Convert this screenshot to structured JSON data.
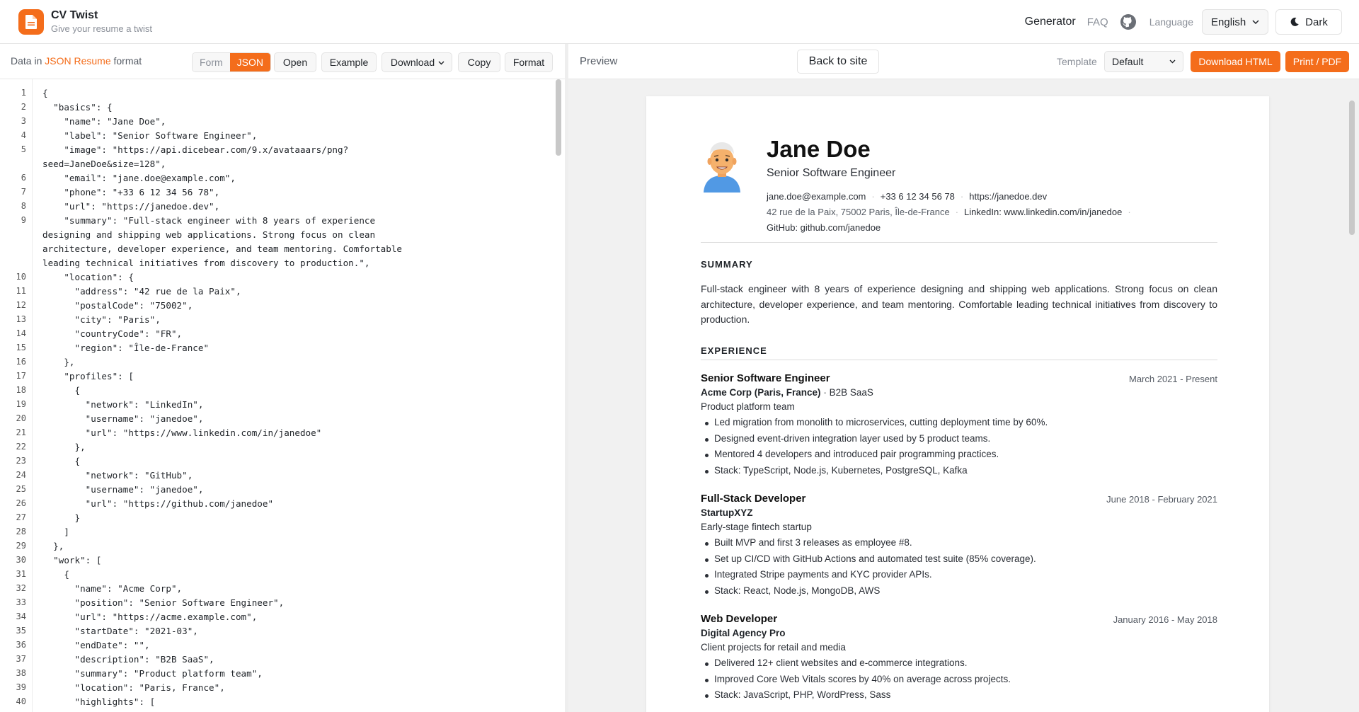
{
  "header": {
    "app_title": "CV Twist",
    "tagline": "Give your resume a twist",
    "nav_generator": "Generator",
    "nav_faq": "FAQ",
    "github_icon": "github-icon",
    "language_label": "Language",
    "language_value": "English",
    "theme_button": "Dark"
  },
  "editor_toolbar": {
    "label_prefix": "Data in",
    "label_highlight": "JSON Resume",
    "label_suffix": "format",
    "mode_form": "Form",
    "mode_json": "JSON",
    "open": "Open",
    "example": "Example",
    "download": "Download",
    "copy": "Copy",
    "format": "Format"
  },
  "editor": {
    "lines": [
      {
        "n": "1",
        "t": "{"
      },
      {
        "n": "2",
        "t": "  \"basics\": {"
      },
      {
        "n": "3",
        "t": "    \"name\": \"Jane Doe\","
      },
      {
        "n": "4",
        "t": "    \"label\": \"Senior Software Engineer\","
      },
      {
        "n": "5",
        "t": "    \"image\": \"https://api.dicebear.com/9.x/avataaars/png?"
      },
      {
        "n": "",
        "t": "seed=JaneDoe&size=128\","
      },
      {
        "n": "6",
        "t": "    \"email\": \"jane.doe@example.com\","
      },
      {
        "n": "7",
        "t": "    \"phone\": \"+33 6 12 34 56 78\","
      },
      {
        "n": "8",
        "t": "    \"url\": \"https://janedoe.dev\","
      },
      {
        "n": "9",
        "t": "    \"summary\": \"Full-stack engineer with 8 years of experience"
      },
      {
        "n": "",
        "t": "designing and shipping web applications. Strong focus on clean"
      },
      {
        "n": "",
        "t": "architecture, developer experience, and team mentoring. Comfortable"
      },
      {
        "n": "",
        "t": "leading technical initiatives from discovery to production.\","
      },
      {
        "n": "10",
        "t": "    \"location\": {"
      },
      {
        "n": "11",
        "t": "      \"address\": \"42 rue de la Paix\","
      },
      {
        "n": "12",
        "t": "      \"postalCode\": \"75002\","
      },
      {
        "n": "13",
        "t": "      \"city\": \"Paris\","
      },
      {
        "n": "14",
        "t": "      \"countryCode\": \"FR\","
      },
      {
        "n": "15",
        "t": "      \"region\": \"Île-de-France\""
      },
      {
        "n": "16",
        "t": "    },"
      },
      {
        "n": "17",
        "t": "    \"profiles\": ["
      },
      {
        "n": "18",
        "t": "      {"
      },
      {
        "n": "19",
        "t": "        \"network\": \"LinkedIn\","
      },
      {
        "n": "20",
        "t": "        \"username\": \"janedoe\","
      },
      {
        "n": "21",
        "t": "        \"url\": \"https://www.linkedin.com/in/janedoe\""
      },
      {
        "n": "22",
        "t": "      },"
      },
      {
        "n": "23",
        "t": "      {"
      },
      {
        "n": "24",
        "t": "        \"network\": \"GitHub\","
      },
      {
        "n": "25",
        "t": "        \"username\": \"janedoe\","
      },
      {
        "n": "26",
        "t": "        \"url\": \"https://github.com/janedoe\""
      },
      {
        "n": "27",
        "t": "      }"
      },
      {
        "n": "28",
        "t": "    ]"
      },
      {
        "n": "29",
        "t": "  },"
      },
      {
        "n": "30",
        "t": "  \"work\": ["
      },
      {
        "n": "31",
        "t": "    {"
      },
      {
        "n": "32",
        "t": "      \"name\": \"Acme Corp\","
      },
      {
        "n": "33",
        "t": "      \"position\": \"Senior Software Engineer\","
      },
      {
        "n": "34",
        "t": "      \"url\": \"https://acme.example.com\","
      },
      {
        "n": "35",
        "t": "      \"startDate\": \"2021-03\","
      },
      {
        "n": "36",
        "t": "      \"endDate\": \"\","
      },
      {
        "n": "37",
        "t": "      \"description\": \"B2B SaaS\","
      },
      {
        "n": "38",
        "t": "      \"summary\": \"Product platform team\","
      },
      {
        "n": "39",
        "t": "      \"location\": \"Paris, France\","
      },
      {
        "n": "40",
        "t": "      \"highlights\": ["
      }
    ]
  },
  "preview_toolbar": {
    "label": "Preview",
    "back": "Back to site",
    "template_label": "Template",
    "template_value": "Default",
    "download_html": "Download HTML",
    "print_pdf": "Print / PDF"
  },
  "resume": {
    "name": "Jane Doe",
    "label": "Senior Software Engineer",
    "email": "jane.doe@example.com",
    "phone": "+33 6 12 34 56 78",
    "url": "https://janedoe.dev",
    "address": "42 rue de la Paix, 75002 Paris, Île-de-France",
    "linkedin": "LinkedIn: www.linkedin.com/in/janedoe",
    "github": "GitHub: github.com/janedoe",
    "summary_title": "SUMMARY",
    "summary": "Full-stack engineer with 8 years of experience designing and shipping web applications. Strong focus on clean architecture, developer experience, and team mentoring. Comfortable leading technical initiatives from discovery to production.",
    "experience_title": "EXPERIENCE",
    "work": [
      {
        "position": "Senior Software Engineer",
        "dates": "March 2021 - Present",
        "company": "Acme Corp (Paris, France)",
        "description": "B2B SaaS",
        "summary": "Product platform team",
        "highlights": [
          "Led migration from monolith to microservices, cutting deployment time by 60%.",
          "Designed event-driven integration layer used by 5 product teams.",
          "Mentored 4 developers and introduced pair programming practices.",
          "Stack: TypeScript, Node.js, Kubernetes, PostgreSQL, Kafka"
        ]
      },
      {
        "position": "Full-Stack Developer",
        "dates": "June 2018 - February 2021",
        "company": "StartupXYZ",
        "description": "",
        "summary": "Early-stage fintech startup",
        "highlights": [
          "Built MVP and first 3 releases as employee #8.",
          "Set up CI/CD with GitHub Actions and automated test suite (85% coverage).",
          "Integrated Stripe payments and KYC provider APIs.",
          "Stack: React, Node.js, MongoDB, AWS"
        ]
      },
      {
        "position": "Web Developer",
        "dates": "January 2016 - May 2018",
        "company": "Digital Agency Pro",
        "description": "",
        "summary": "Client projects for retail and media",
        "highlights": [
          "Delivered 12+ client websites and e-commerce integrations.",
          "Improved Core Web Vitals scores by 40% on average across projects.",
          "Stack: JavaScript, PHP, WordPress, Sass"
        ]
      }
    ]
  },
  "colors": {
    "accent": "#f46d1b",
    "text": "#1f2328",
    "muted": "#8a8f98",
    "preview_bg": "#f1f1f1"
  }
}
